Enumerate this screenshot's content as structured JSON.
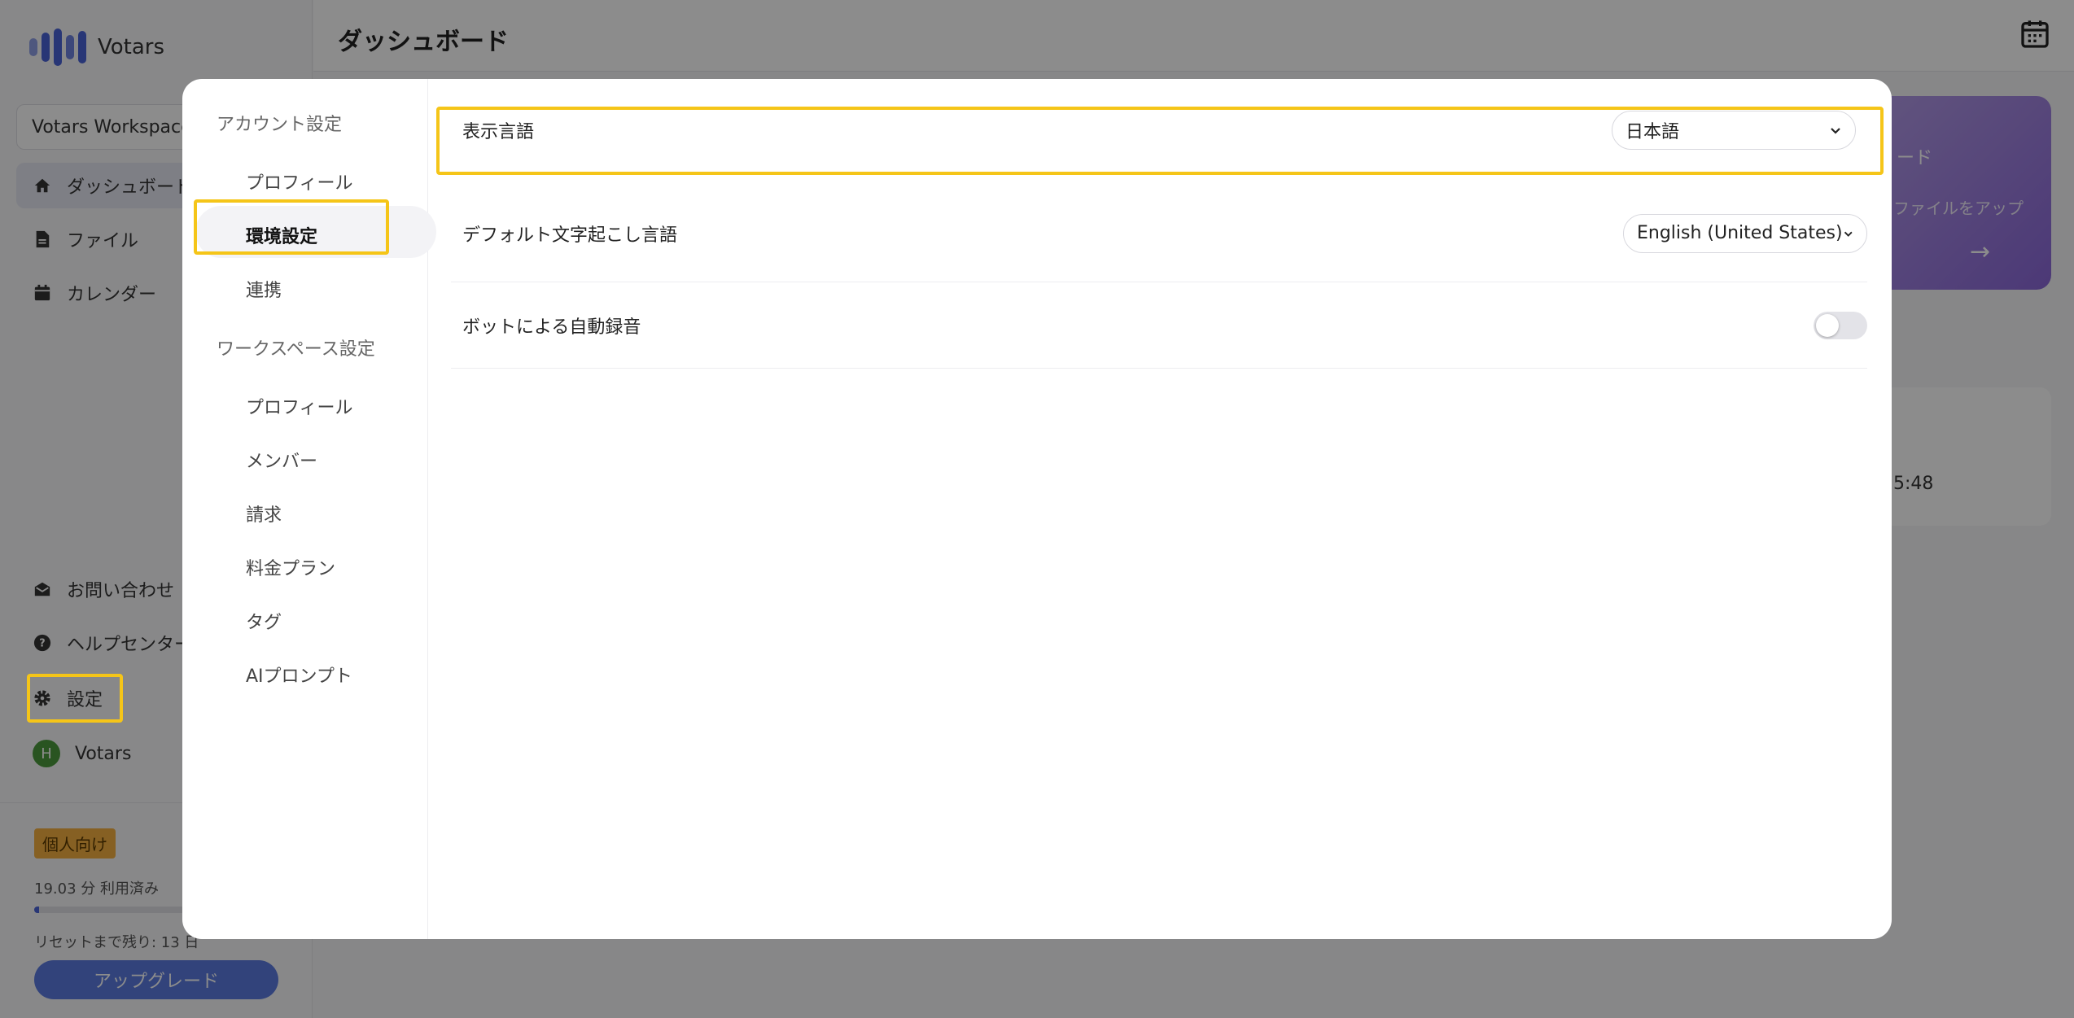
{
  "app": {
    "name": "Votars"
  },
  "sidebar": {
    "workspace": "Votars Workspace",
    "items": [
      {
        "label": "ダッシュボード",
        "icon": "home-icon"
      },
      {
        "label": "ファイル",
        "icon": "file-icon"
      },
      {
        "label": "カレンダー",
        "icon": "calendar-icon"
      }
    ],
    "bottom_items": [
      {
        "label": "お問い合わせ",
        "icon": "mail-icon"
      },
      {
        "label": "ヘルプセンター",
        "icon": "help-icon"
      },
      {
        "label": "設定",
        "icon": "gear-icon"
      }
    ],
    "user": {
      "initial": "H",
      "name": "Votars"
    },
    "plan_badge": "個人向け",
    "usage_text": "19.03 分 利用済み",
    "usage_fraction": 0.02,
    "reset_text": "リセットまで残り: 13 日",
    "upgrade_label": "アップグレード"
  },
  "header": {
    "title": "ダッシュボード"
  },
  "background_cards": {
    "promo_title": "ード",
    "promo_text": "ファイルをアップ",
    "recording_time": "5:48"
  },
  "settings_modal": {
    "nav": {
      "account_group": "アカウント設定",
      "account_items": [
        "プロフィール",
        "環境設定",
        "連携"
      ],
      "workspace_group": "ワークスペース設定",
      "workspace_items": [
        "プロフィール",
        "メンバー",
        "請求",
        "料金プラン",
        "タグ",
        "AIプロンプト"
      ]
    },
    "rows": {
      "display_language": {
        "label": "表示言語",
        "value": "日本語"
      },
      "transcription_language": {
        "label": "デフォルト文字起こし言語",
        "value": "English (United States)"
      },
      "bot_recording": {
        "label": "ボットによる自動録音",
        "enabled": false
      }
    }
  },
  "colors": {
    "accent": "#4a63d8",
    "highlight": "#f5c518",
    "promo": "#8a67d8"
  }
}
